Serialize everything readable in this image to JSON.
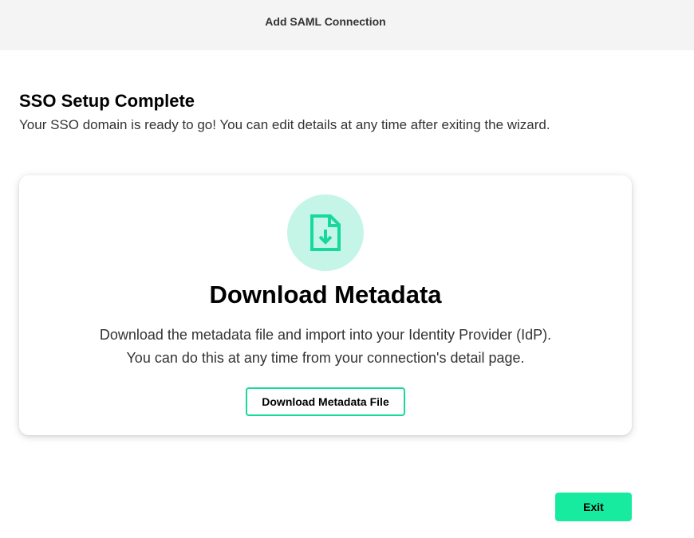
{
  "header": {
    "title": "Add SAML Connection"
  },
  "main": {
    "title": "SSO Setup Complete",
    "subtitle": "Your SSO domain is ready to go! You can edit details at any time after exiting the wizard."
  },
  "card": {
    "icon": "document-download-icon",
    "title": "Download Metadata",
    "description_line1": "Download the metadata file and import into your Identity Provider (IdP).",
    "description_line2": "You can do this at any time from your connection's detail page.",
    "button_label": "Download Metadata File"
  },
  "footer": {
    "exit_label": "Exit"
  },
  "colors": {
    "accent": "#17eba0",
    "accent_border": "#17d99c",
    "icon_circle": "#c5f5e6",
    "header_bg": "#f4f4f4"
  }
}
